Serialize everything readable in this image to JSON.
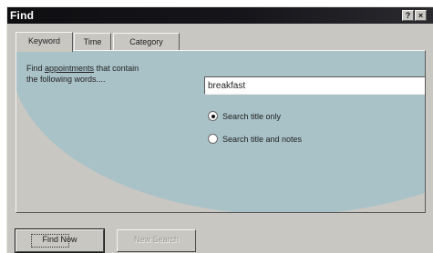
{
  "window": {
    "title": "Find",
    "help_button": "?",
    "close_button": "×"
  },
  "tabs": [
    {
      "label": "Keyword",
      "active": true
    },
    {
      "label": "Time",
      "active": false
    },
    {
      "label": "Category",
      "active": false
    }
  ],
  "keyword": {
    "prompt_line1_pre": "Find ",
    "prompt_line1_ul": "appointments",
    "prompt_line1_post": " that contain",
    "prompt_line2": "the following words....",
    "search_value": "breakfast",
    "options": [
      {
        "label": "Search title only",
        "selected": true
      },
      {
        "label": "Search title and notes",
        "selected": false
      }
    ]
  },
  "buttons": {
    "find_now": "Find Now",
    "new_search": "New Search"
  },
  "colors": {
    "dialog_face": "#c9c7c2",
    "accent_swoosh": "#a9c2c8",
    "titlebar": "#15151a"
  }
}
